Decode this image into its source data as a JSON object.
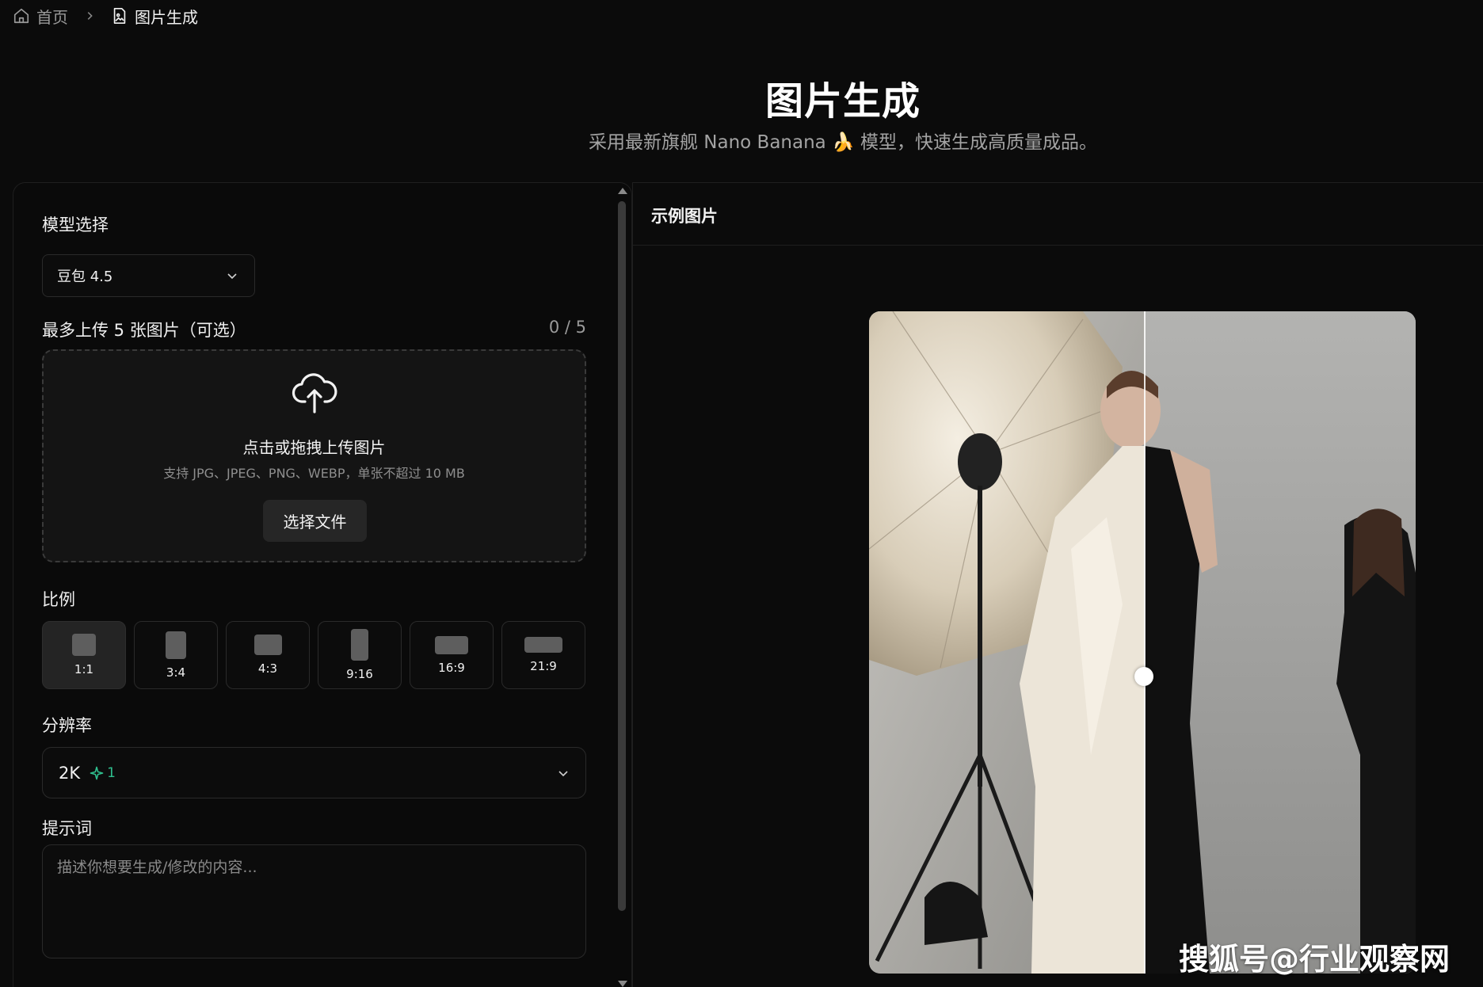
{
  "breadcrumb": {
    "home": "首页",
    "current": "图片生成"
  },
  "hero": {
    "title": "图片生成",
    "subtitle": "采用最新旗舰 Nano Banana 🍌 模型，快速生成高质量成品。"
  },
  "form": {
    "model": {
      "label": "模型选择",
      "value": "豆包 4.5"
    },
    "upload": {
      "label": "最多上传 5 张图片（可选）",
      "count": "0 / 5",
      "title": "点击或拖拽上传图片",
      "hint": "支持 JPG、JPEG、PNG、WEBP，单张不超过 10 MB",
      "button": "选择文件"
    },
    "ratio": {
      "label": "比例",
      "options": [
        "1:1",
        "3:4",
        "4:3",
        "9:16",
        "16:9",
        "21:9"
      ],
      "selected": "1:1"
    },
    "resolution": {
      "label": "分辨率",
      "value": "2K",
      "credits": "1"
    },
    "prompt": {
      "label": "提示词",
      "placeholder": "描述你想要生成/修改的内容..."
    }
  },
  "example": {
    "title": "示例图片"
  },
  "watermark": "搜狐号@行业观察网",
  "colors": {
    "background": "#0b0b0b",
    "panel_border": "#1f1f1f",
    "accent_green": "#2fbf8e",
    "selected_ratio_bg": "#242424"
  },
  "icons": {
    "breadcrumb_home": "home-icon",
    "breadcrumb_separator": "chevron-right-icon",
    "breadcrumb_current": "image-file-icon",
    "dropdown": "chevron-down-icon",
    "upload": "cloud-upload-icon",
    "credits": "sparkle-icon"
  }
}
